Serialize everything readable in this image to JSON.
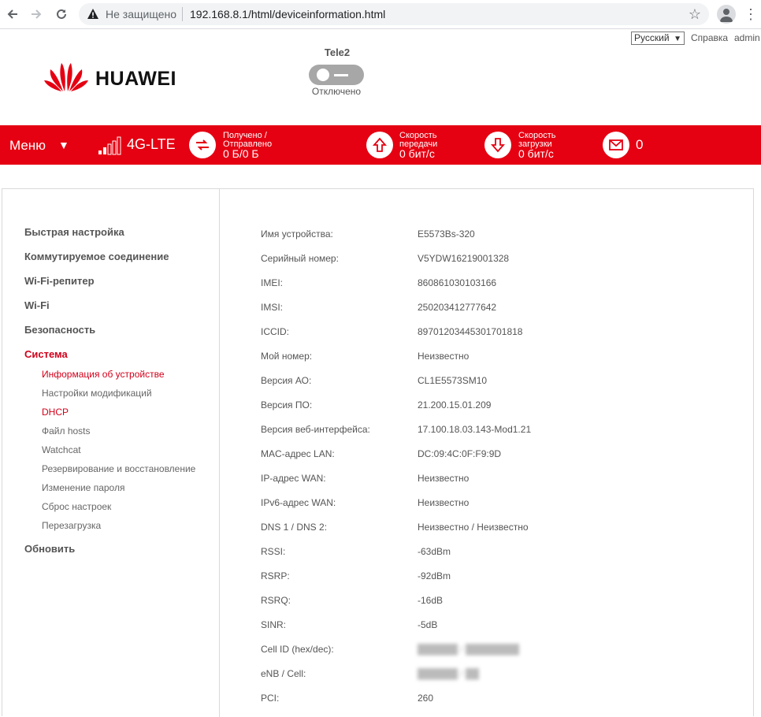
{
  "browser": {
    "security_label": "Не защищено",
    "url": "192.168.8.1/html/deviceinformation.html"
  },
  "header": {
    "language": "Русский",
    "help_link": "Справка",
    "user_link": "admin",
    "brand": "HUAWEI",
    "operator": "Tele2",
    "connection_status": "Отключено"
  },
  "statusbar": {
    "menu_label": "Меню",
    "network_type": "4G-LTE",
    "received_sent_label_1": "Получено /",
    "received_sent_label_2": "Отправлено",
    "received_sent_value": "0 Б/0 Б",
    "upload_label_1": "Скорость",
    "upload_label_2": "передачи",
    "upload_value": "0 бит/с",
    "download_label_1": "Скорость",
    "download_label_2": "загрузки",
    "download_value": "0 бит/с",
    "messages_count": "0"
  },
  "sidebar": {
    "items": [
      {
        "label": "Быстрая настройка"
      },
      {
        "label": "Коммутируемое соединение"
      },
      {
        "label": "Wi-Fi-репитер"
      },
      {
        "label": "Wi-Fi"
      },
      {
        "label": "Безопасность"
      },
      {
        "label": "Система",
        "active": true
      },
      {
        "label": "Обновить"
      }
    ],
    "subitems": [
      {
        "label": "Информация об устройстве",
        "active": true
      },
      {
        "label": "Настройки модификаций"
      },
      {
        "label": "DHCP",
        "active": true
      },
      {
        "label": "Файл hosts"
      },
      {
        "label": "Watchcat"
      },
      {
        "label": "Резервирование и восстановление"
      },
      {
        "label": "Изменение пароля"
      },
      {
        "label": "Сброс настроек"
      },
      {
        "label": "Перезагрузка"
      }
    ]
  },
  "device_info": {
    "rows": [
      {
        "label": "Имя устройства:",
        "value": "E5573Bs-320"
      },
      {
        "label": "Серийный номер:",
        "value": "V5YDW16219001328"
      },
      {
        "label": "IMEI:",
        "value": "860861030103166"
      },
      {
        "label": "IMSI:",
        "value": "250203412777642"
      },
      {
        "label": "ICCID:",
        "value": "89701203445301701818"
      },
      {
        "label": "Мой номер:",
        "value": "Неизвестно"
      },
      {
        "label": "Версия АО:",
        "value": "CL1E5573SM10"
      },
      {
        "label": "Версия ПО:",
        "value": "21.200.15.01.209"
      },
      {
        "label": "Версия веб-интерфейса:",
        "value": "17.100.18.03.143-Mod1.21"
      },
      {
        "label": "MAC-адрес LAN:",
        "value": "DC:09:4C:0F:F9:9D"
      },
      {
        "label": "IP-адрес WAN:",
        "value": "Неизвестно"
      },
      {
        "label": "IPv6-адрес WAN:",
        "value": "Неизвестно"
      },
      {
        "label": "DNS 1 / DNS 2:",
        "value": "Неизвестно / Неизвестно"
      },
      {
        "label": "RSSI:",
        "value": "-63dBm"
      },
      {
        "label": "RSRP:",
        "value": "-92dBm"
      },
      {
        "label": "RSRQ:",
        "value": "-16dB"
      },
      {
        "label": "SINR:",
        "value": "-5dB"
      },
      {
        "label": "Cell ID (hex/dec):",
        "value": "",
        "blurred": true
      },
      {
        "label": "eNB / Cell:",
        "value": "",
        "blurred": true
      },
      {
        "label": "PCI:",
        "value": "260"
      }
    ]
  },
  "colors": {
    "brand_red": "#e50012",
    "active_red": "#d2001a"
  }
}
